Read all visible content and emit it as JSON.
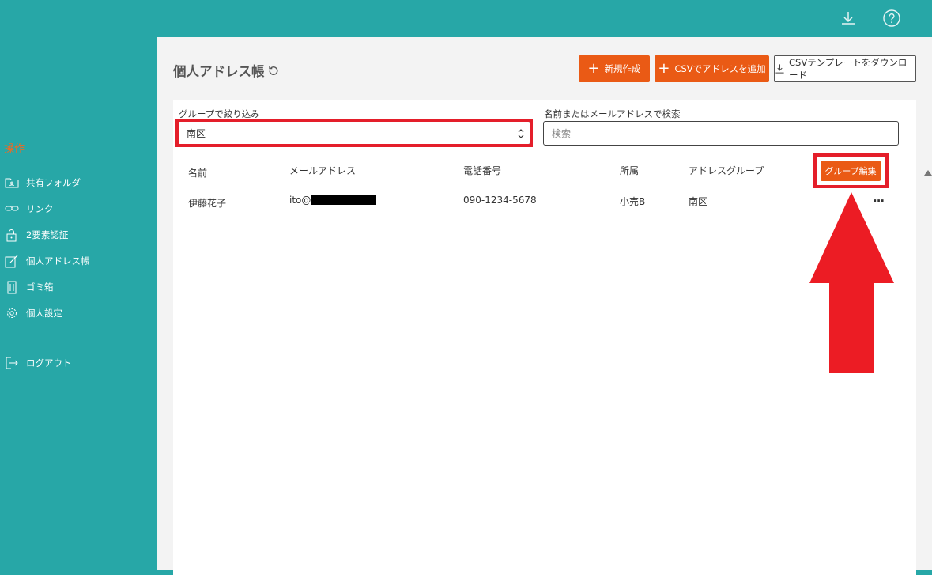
{
  "topbar": {
    "download_icon": "download-icon",
    "help_icon": "help-circle-icon"
  },
  "sidebar": {
    "heading": "操作",
    "items": [
      {
        "label": "共有フォルダ",
        "icon": "shared-folder-icon"
      },
      {
        "label": "リンク",
        "icon": "link-icon"
      },
      {
        "label": "2要素認証",
        "icon": "lock-icon"
      },
      {
        "label": "個人アドレス帳",
        "icon": "edit-icon"
      },
      {
        "label": "ゴミ箱",
        "icon": "trash-icon"
      },
      {
        "label": "個人設定",
        "icon": "gear-icon"
      },
      {
        "label": "ログアウト",
        "icon": "logout-icon"
      }
    ]
  },
  "main": {
    "title": "個人アドレス帳",
    "buttons": {
      "new": "新規作成",
      "csv_add": "CSVでアドレスを追加",
      "csv_template": "CSVテンプレートをダウンロード"
    },
    "filter": {
      "group_label": "グループで絞り込み",
      "group_value": "南区",
      "search_label": "名前またはメールアドレスで検索",
      "search_placeholder": "検索"
    },
    "table": {
      "columns": [
        "名前",
        "メールアドレス",
        "電話番号",
        "所属",
        "アドレスグループ"
      ],
      "group_edit_button": "グループ編集",
      "rows": [
        {
          "name": "伊藤花子",
          "email": "ito@",
          "phone": "090-1234-5678",
          "affiliation": "小売B",
          "group": "南区",
          "menu": "..."
        }
      ]
    }
  },
  "colors": {
    "teal": "#27a7a7",
    "orange": "#ea5a15",
    "highlight_red": "#e41e2a"
  }
}
